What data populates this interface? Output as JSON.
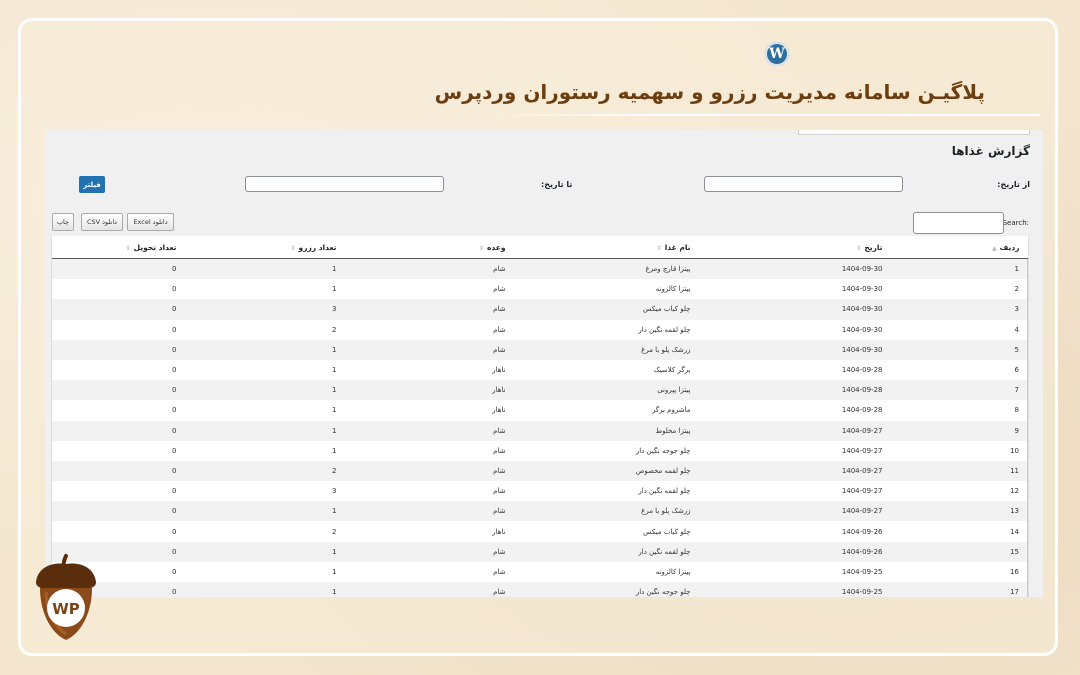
{
  "header": {
    "wp_logo_letter": "W",
    "title": "پلاگیـن سامانه مدیریت رزرو و سهمیه رستوران وردپرس"
  },
  "page": {
    "title": "گزارش غذاها",
    "from_date_label": "از تاریخ:",
    "to_date_label": "تا تاریخ:",
    "filter_button": "فیلتر",
    "print_button": "چاپ",
    "csv_button": "دانلود CSV",
    "excel_button": "دانلود Excel",
    "search_label": "Search:"
  },
  "table": {
    "columns": [
      "ردیف",
      "تاریخ",
      "نام غذا",
      "وعده",
      "تعداد رزرو",
      "تعداد تحویل"
    ],
    "rows": [
      [
        "1",
        "1404-09-30",
        "پیتزا قارچ ومرغ",
        "شام",
        "1",
        "0"
      ],
      [
        "2",
        "1404-09-30",
        "پیتزا کالزونه",
        "شام",
        "1",
        "0"
      ],
      [
        "3",
        "1404-09-30",
        "چلو کباب میکس",
        "شام",
        "3",
        "0"
      ],
      [
        "4",
        "1404-09-30",
        "چلو لقمه نگین دار",
        "شام",
        "2",
        "0"
      ],
      [
        "5",
        "1404-09-30",
        "زرشک پلو با مرغ",
        "شام",
        "1",
        "0"
      ],
      [
        "6",
        "1404-09-28",
        "برگر کلاسیک",
        "ناهار",
        "1",
        "0"
      ],
      [
        "7",
        "1404-09-28",
        "پیتزا پپرونی",
        "ناهار",
        "1",
        "0"
      ],
      [
        "8",
        "1404-09-28",
        "ماشروم برگر",
        "ناهار",
        "1",
        "0"
      ],
      [
        "9",
        "1404-09-27",
        "پیتزا مخلوط",
        "شام",
        "1",
        "0"
      ],
      [
        "10",
        "1404-09-27",
        "چلو جوجه نگین دار",
        "شام",
        "1",
        "0"
      ],
      [
        "11",
        "1404-09-27",
        "چلو لقمه مخصوص",
        "شام",
        "2",
        "0"
      ],
      [
        "12",
        "1404-09-27",
        "چلو لقمه نگین دار",
        "شام",
        "3",
        "0"
      ],
      [
        "13",
        "1404-09-27",
        "زرشک پلو با مرغ",
        "شام",
        "1",
        "0"
      ],
      [
        "14",
        "1404-09-26",
        "چلو کباب میکس",
        "ناهار",
        "2",
        "0"
      ],
      [
        "15",
        "1404-09-26",
        "چلو لقمه نگین دار",
        "شام",
        "1",
        "0"
      ],
      [
        "16",
        "1404-09-25",
        "پیتزا کالزونه",
        "شام",
        "1",
        "0"
      ],
      [
        "17",
        "1404-09-25",
        "چلو جوجه نگین دار",
        "شام",
        "1",
        "0"
      ]
    ]
  },
  "badge": {
    "text": "WP"
  },
  "colors": {
    "accent": "#2271b1",
    "title_brown": "#6d3e10",
    "acorn": "#7a4418"
  }
}
